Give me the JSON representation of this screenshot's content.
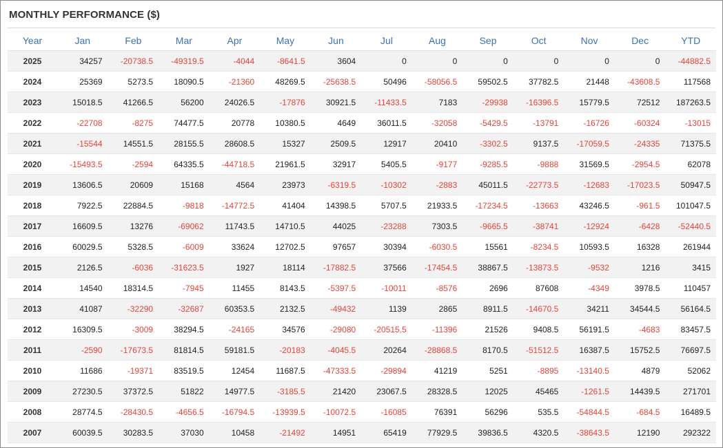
{
  "title": "MONTHLY PERFORMANCE ($)",
  "colors": {
    "header": "#3c72b3",
    "negative": "#e8433a",
    "positive": "#222222",
    "stripe": "#f2f2f2"
  },
  "columns": [
    "Year",
    "Jan",
    "Feb",
    "Mar",
    "Apr",
    "May",
    "Jun",
    "Jul",
    "Aug",
    "Sep",
    "Oct",
    "Nov",
    "Dec",
    "YTD"
  ],
  "rows": [
    [
      "2025",
      "34257",
      "-20738.5",
      "-49319.5",
      "-4044",
      "-8641.5",
      "3604",
      "0",
      "0",
      "0",
      "0",
      "0",
      "0",
      "-44882.5"
    ],
    [
      "2024",
      "25369",
      "5273.5",
      "18090.5",
      "-21360",
      "48269.5",
      "-25638.5",
      "50496",
      "-58056.5",
      "59502.5",
      "37782.5",
      "21448",
      "-43608.5",
      "117568"
    ],
    [
      "2023",
      "15018.5",
      "41266.5",
      "56200",
      "24026.5",
      "-17876",
      "30921.5",
      "-11433.5",
      "7183",
      "-29938",
      "-16396.5",
      "15779.5",
      "72512",
      "187263.5"
    ],
    [
      "2022",
      "-22708",
      "-8275",
      "74477.5",
      "20778",
      "10380.5",
      "4649",
      "36011.5",
      "-32058",
      "-5429.5",
      "-13791",
      "-16726",
      "-60324",
      "-13015"
    ],
    [
      "2021",
      "-15544",
      "14551.5",
      "28155.5",
      "28608.5",
      "15327",
      "2509.5",
      "12917",
      "20410",
      "-3302.5",
      "9137.5",
      "-17059.5",
      "-24335",
      "71375.5"
    ],
    [
      "2020",
      "-15493.5",
      "-2594",
      "64335.5",
      "-44718.5",
      "21961.5",
      "32917",
      "5405.5",
      "-9177",
      "-9285.5",
      "-9888",
      "31569.5",
      "-2954.5",
      "62078"
    ],
    [
      "2019",
      "13606.5",
      "20609",
      "15168",
      "4564",
      "23973",
      "-6319.5",
      "-10302",
      "-2883",
      "45011.5",
      "-22773.5",
      "-12683",
      "-17023.5",
      "50947.5"
    ],
    [
      "2018",
      "7922.5",
      "22884.5",
      "-9818",
      "-14772.5",
      "41404",
      "14398.5",
      "5707.5",
      "21933.5",
      "-17234.5",
      "-13663",
      "43246.5",
      "-961.5",
      "101047.5"
    ],
    [
      "2017",
      "16609.5",
      "13276",
      "-69062",
      "11743.5",
      "14710.5",
      "44025",
      "-23288",
      "7303.5",
      "-9665.5",
      "-38741",
      "-12924",
      "-6428",
      "-52440.5"
    ],
    [
      "2016",
      "60029.5",
      "5328.5",
      "-6009",
      "33624",
      "12702.5",
      "97657",
      "30394",
      "-6030.5",
      "15561",
      "-8234.5",
      "10593.5",
      "16328",
      "261944"
    ],
    [
      "2015",
      "2126.5",
      "-6036",
      "-31623.5",
      "1927",
      "18114",
      "-17882.5",
      "37566",
      "-17454.5",
      "38867.5",
      "-13873.5",
      "-9532",
      "1216",
      "3415"
    ],
    [
      "2014",
      "14540",
      "18314.5",
      "-7945",
      "11455",
      "8143.5",
      "-5397.5",
      "-10011",
      "-8576",
      "2696",
      "87608",
      "-4349",
      "3978.5",
      "110457"
    ],
    [
      "2013",
      "41087",
      "-32290",
      "-32687",
      "60353.5",
      "2132.5",
      "-49432",
      "1139",
      "2865",
      "8911.5",
      "-14670.5",
      "34211",
      "34544.5",
      "56164.5"
    ],
    [
      "2012",
      "16309.5",
      "-3009",
      "38294.5",
      "-24165",
      "34576",
      "-29080",
      "-20515.5",
      "-11396",
      "21526",
      "9408.5",
      "56191.5",
      "-4683",
      "83457.5"
    ],
    [
      "2011",
      "-2590",
      "-17673.5",
      "81814.5",
      "59181.5",
      "-20183",
      "-4045.5",
      "20264",
      "-28868.5",
      "8170.5",
      "-51512.5",
      "16387.5",
      "15752.5",
      "76697.5"
    ],
    [
      "2010",
      "11686",
      "-19371",
      "83519.5",
      "12454",
      "11687.5",
      "-47333.5",
      "-29894",
      "41219",
      "5251",
      "-8895",
      "-13140.5",
      "4879",
      "52062"
    ],
    [
      "2009",
      "27230.5",
      "37372.5",
      "51822",
      "14977.5",
      "-3185.5",
      "21420",
      "23067.5",
      "28328.5",
      "12025",
      "45465",
      "-1261.5",
      "14439.5",
      "271701"
    ],
    [
      "2008",
      "28774.5",
      "-28430.5",
      "-4656.5",
      "-16794.5",
      "-13939.5",
      "-10072.5",
      "-16085",
      "76391",
      "56296",
      "535.5",
      "-54844.5",
      "-684.5",
      "16489.5"
    ],
    [
      "2007",
      "60039.5",
      "30283.5",
      "37030",
      "10458",
      "-21492",
      "14951",
      "65419",
      "77929.5",
      "39836.5",
      "4320.5",
      "-38643.5",
      "12190",
      "292322"
    ]
  ]
}
